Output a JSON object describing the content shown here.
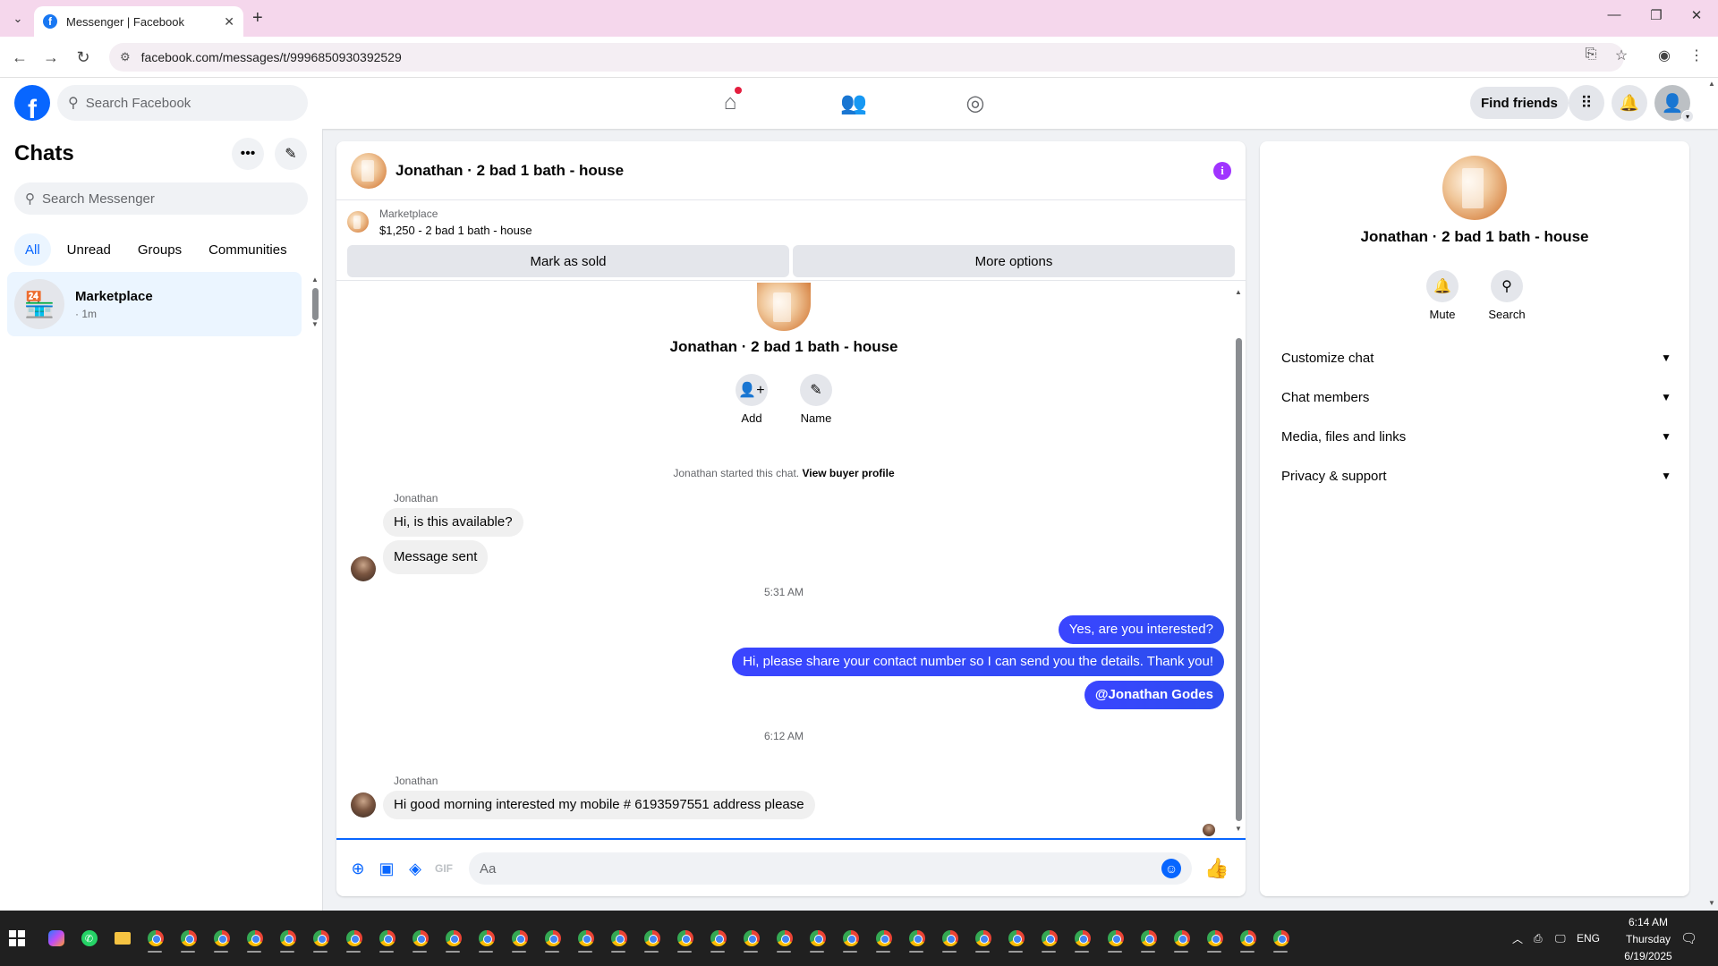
{
  "browser": {
    "tab_title": "Messenger | Facebook",
    "url": "facebook.com/messages/t/9996850930392529"
  },
  "header": {
    "search_placeholder": "Search Facebook",
    "find_friends": "Find friends"
  },
  "chats": {
    "title": "Chats",
    "search_placeholder": "Search Messenger",
    "filters": [
      "All",
      "Unread",
      "Groups",
      "Communities"
    ],
    "active_filter": "All",
    "items": [
      {
        "name": "Marketplace",
        "time": "· 1m"
      }
    ]
  },
  "conversation": {
    "title": "Jonathan · 2 bad 1 bath - house",
    "marketplace_label": "Marketplace",
    "marketplace_item": "$1,250 - 2 bad 1 bath - house",
    "mark_sold": "Mark as sold",
    "more_options": "More options",
    "intro_name": "Jonathan · 2 bad 1 bath - house",
    "intro_actions": [
      "Add",
      "Name"
    ],
    "started_text": "Jonathan started this chat.",
    "view_profile": "View buyer profile",
    "messages": {
      "sender1": "Jonathan",
      "in1": "Hi, is this available?",
      "in2": "Message sent",
      "ts1": "5:31 AM",
      "out1": "Yes, are you interested?",
      "out2": "Hi, please share your contact number so I can send you the details. Thank you!",
      "out3": "@Jonathan Godes",
      "ts2": "6:12 AM",
      "sender2": "Jonathan",
      "in3": "Hi good morning interested my mobile # 6193597551 address please"
    },
    "composer_placeholder": "Aa"
  },
  "info_panel": {
    "name": "Jonathan · 2 bad 1 bath - house",
    "actions": [
      "Mute",
      "Search"
    ],
    "sections": [
      "Customize chat",
      "Chat members",
      "Media, files and links",
      "Privacy & support"
    ]
  },
  "taskbar": {
    "lang": "ENG",
    "time": "6:14 AM",
    "day": "Thursday",
    "date": "6/19/2025"
  },
  "colors": {
    "fb_blue": "#0866ff",
    "outgoing_bubble": "#3a45ff",
    "info_icon": "#a033ff",
    "tab_bar": "#f5d7ec"
  }
}
